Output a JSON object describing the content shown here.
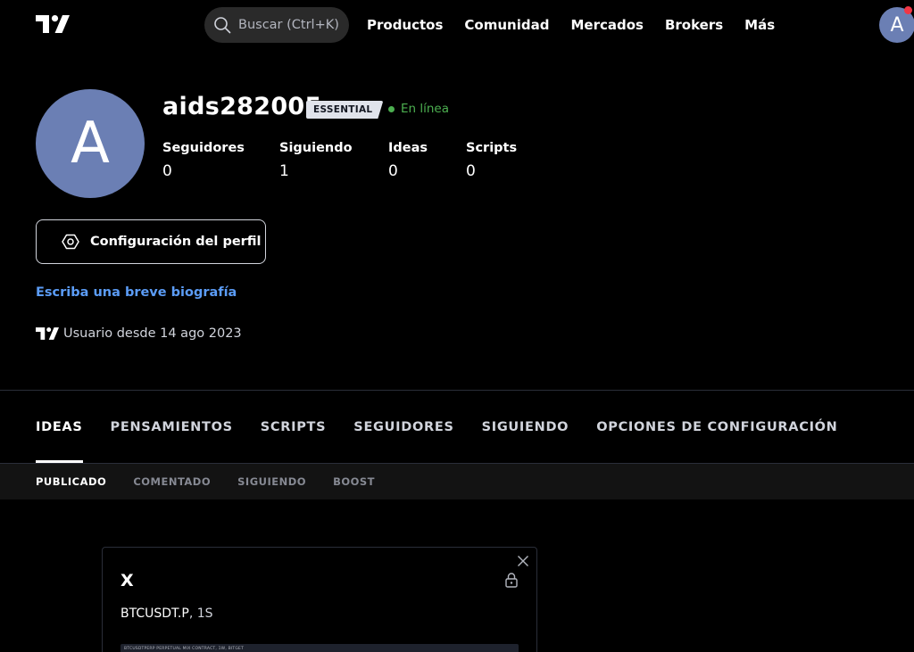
{
  "nav": {
    "search_placeholder": "Buscar (Ctrl+K)",
    "links": [
      "Productos",
      "Comunidad",
      "Mercados",
      "Brokers",
      "Más"
    ],
    "avatar_initial": "A"
  },
  "profile": {
    "avatar_initial": "A",
    "username": "aids282005",
    "plan_badge": "ESSENTIAL",
    "status": "En línea",
    "stats": [
      {
        "label": "Seguidores",
        "value": "0"
      },
      {
        "label": "Siguiendo",
        "value": "1"
      },
      {
        "label": "Ideas",
        "value": "0"
      },
      {
        "label": "Scripts",
        "value": "0"
      }
    ],
    "config_button": "Configuración del perfil",
    "bio_link": "Escriba una breve biografía",
    "joined": "Usuario desde 14 ago 2023"
  },
  "tabs": {
    "items": [
      "IDEAS",
      "PENSAMIENTOS",
      "SCRIPTS",
      "SEGUIDORES",
      "SIGUIENDO",
      "OPCIONES DE CONFIGURACIÓN"
    ],
    "active": "IDEAS"
  },
  "subtabs": {
    "items": [
      "PUBLICADO",
      "COMENTADO",
      "SIGUIENDO",
      "BOOST"
    ],
    "active": "PUBLICADO"
  },
  "card": {
    "title": "X",
    "symbol": "BTCUSDT.P",
    "interval": ", 1S",
    "chart_label": "BTCUSDTPERP PERPETUAL MIX CONTRACT, 1W, BITGET"
  },
  "colors": {
    "background": "#000000",
    "avatar": "#6b7fb4",
    "online": "#4caf50",
    "link": "#5b9cf6",
    "notification": "#f23645"
  },
  "icons": {
    "logo": "tradingview-logo-icon",
    "search": "search-icon",
    "config": "hexagon-gear-icon",
    "close": "close-icon",
    "lock": "lock-icon"
  }
}
